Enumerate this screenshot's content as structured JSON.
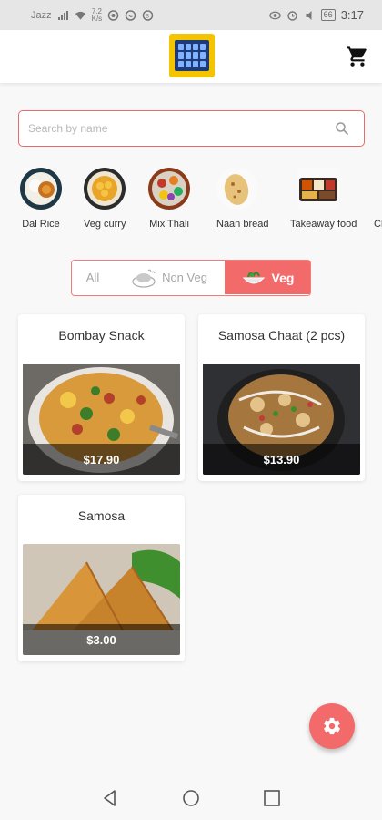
{
  "status_bar": {
    "carrier": "Jazz",
    "speed_value": "7.2",
    "speed_unit": "K/s",
    "battery": "66",
    "time": "3:17"
  },
  "app_bar": {
    "logo_icon": "tablet-menu-logo",
    "cart_icon": "cart-icon"
  },
  "search": {
    "placeholder": "Search by name",
    "value": "",
    "icon": "search-icon"
  },
  "categories": [
    {
      "label": "Dal Rice"
    },
    {
      "label": "Veg curry"
    },
    {
      "label": "Mix Thali"
    },
    {
      "label": "Naan bread"
    },
    {
      "label": "Takeaway food"
    },
    {
      "label": "Ch"
    }
  ],
  "filter": {
    "options": [
      {
        "label": "All",
        "selected": false
      },
      {
        "label": "Non Veg",
        "selected": false
      },
      {
        "label": "Veg",
        "selected": true
      }
    ]
  },
  "products": [
    {
      "name": "Bombay Snack",
      "price": "$17.90"
    },
    {
      "name": "Samosa Chaat (2 pcs)",
      "price": "$13.90"
    },
    {
      "name": "Samosa",
      "price": "$3.00"
    }
  ],
  "colors": {
    "accent": "#f26a6a",
    "logo_yellow": "#f5c400",
    "logo_blue": "#1e3a78"
  },
  "fab": {
    "icon": "gear-icon"
  },
  "nav": {
    "icons": [
      "back-icon",
      "home-icon",
      "recents-icon"
    ]
  }
}
